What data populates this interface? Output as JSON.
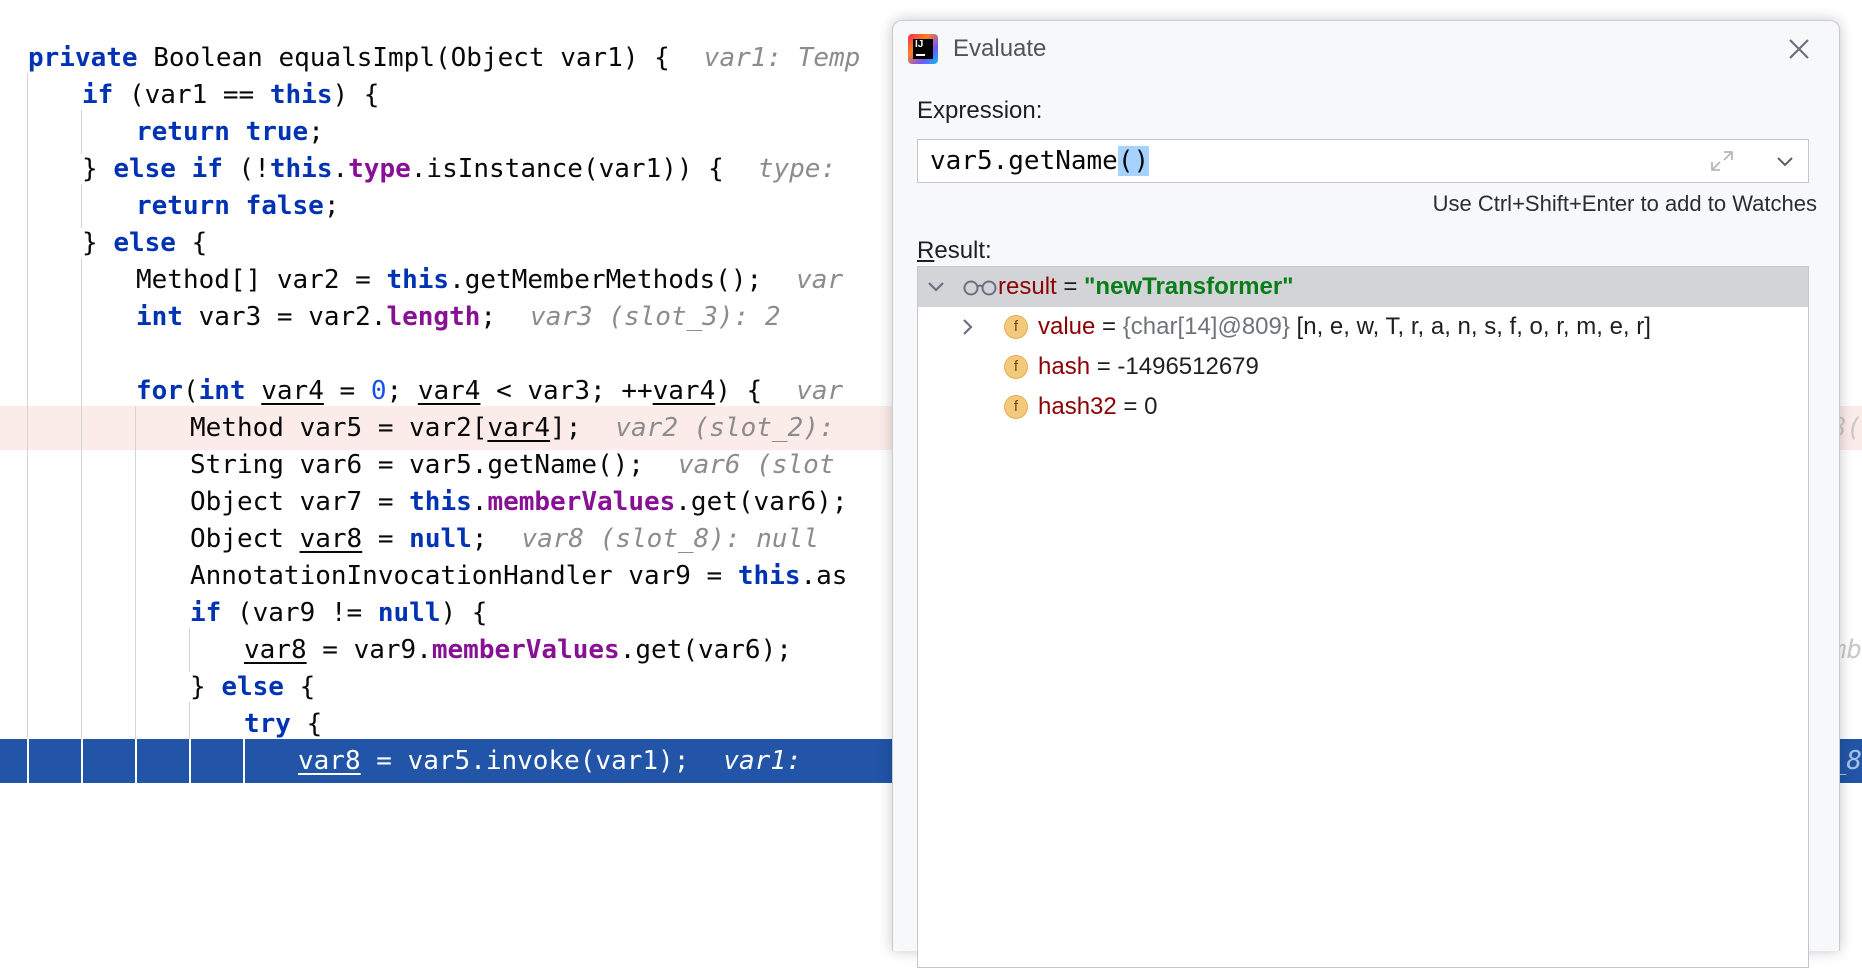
{
  "editor": {
    "lines": [
      {
        "parts": [
          {
            "t": "private",
            "c": "kw"
          },
          {
            "t": " Boolean equalsImpl(Object var1) {"
          }
        ],
        "hint": "var1: Temp"
      },
      {
        "parts": [
          {
            "t": "if",
            "c": "kw"
          },
          {
            "t": " (var1 == "
          },
          {
            "t": "this",
            "c": "kw"
          },
          {
            "t": ") {"
          }
        ]
      },
      {
        "parts": [
          {
            "t": "return true",
            "c": "kw"
          },
          {
            "t": ";"
          }
        ]
      },
      {
        "parts": [
          {
            "t": "} "
          },
          {
            "t": "else if",
            "c": "kw"
          },
          {
            "t": " (!"
          },
          {
            "t": "this",
            "c": "kw"
          },
          {
            "t": "."
          },
          {
            "t": "type",
            "c": "fld"
          },
          {
            "t": ".isInstance(var1)) {"
          }
        ],
        "hint": "type: "
      },
      {
        "parts": [
          {
            "t": "return false",
            "c": "kw"
          },
          {
            "t": ";"
          }
        ]
      },
      {
        "parts": [
          {
            "t": "} "
          },
          {
            "t": "else",
            "c": "kw"
          },
          {
            "t": " {"
          }
        ]
      },
      {
        "parts": [
          {
            "t": "Method[] var2 = "
          },
          {
            "t": "this",
            "c": "kw"
          },
          {
            "t": ".getMemberMethods();"
          }
        ],
        "hint": "var"
      },
      {
        "parts": [
          {
            "t": "int",
            "c": "kw"
          },
          {
            "t": " var3 = var2."
          },
          {
            "t": "length",
            "c": "fld"
          },
          {
            "t": ";"
          }
        ],
        "hint": "var3 (slot_3): 2"
      },
      {
        "parts": []
      },
      {
        "parts": [
          {
            "t": "for",
            "c": "kw"
          },
          {
            "t": "("
          },
          {
            "t": "int",
            "c": "kw"
          },
          {
            "t": " "
          },
          {
            "t": "var4",
            "c": "u"
          },
          {
            "t": " = "
          },
          {
            "t": "0",
            "c": "num"
          },
          {
            "t": "; "
          },
          {
            "t": "var4",
            "c": "u"
          },
          {
            "t": " < var3; ++"
          },
          {
            "t": "var4",
            "c": "u"
          },
          {
            "t": ") {"
          }
        ],
        "hint": "var"
      },
      {
        "parts": [
          {
            "t": "Method var5 = var2["
          },
          {
            "t": "var4",
            "c": "u"
          },
          {
            "t": "];"
          }
        ],
        "hint": "var2 (slot_2):",
        "right": "8("
      },
      {
        "parts": [
          {
            "t": "String var6 = var5.getName();"
          }
        ],
        "hint": "var6 (slot"
      },
      {
        "parts": [
          {
            "t": "Object var7 = "
          },
          {
            "t": "this",
            "c": "kw"
          },
          {
            "t": "."
          },
          {
            "t": "memberValues",
            "c": "fld"
          },
          {
            "t": ".get(var6);"
          }
        ]
      },
      {
        "parts": [
          {
            "t": "Object "
          },
          {
            "t": "var8",
            "c": "u"
          },
          {
            "t": " = "
          },
          {
            "t": "null",
            "c": "kw"
          },
          {
            "t": ";"
          }
        ],
        "hint": "var8 (slot_8): null"
      },
      {
        "parts": [
          {
            "t": "AnnotationInvocationHandler var9 = "
          },
          {
            "t": "this",
            "c": "kw"
          },
          {
            "t": ".as"
          }
        ]
      },
      {
        "parts": [
          {
            "t": "if",
            "c": "kw"
          },
          {
            "t": " (var9 != "
          },
          {
            "t": "null",
            "c": "kw"
          },
          {
            "t": ") {"
          }
        ]
      },
      {
        "parts": [
          {
            "t": "var8",
            "c": "u"
          },
          {
            "t": " = var9."
          },
          {
            "t": "memberValues",
            "c": "fld"
          },
          {
            "t": ".get(var6);"
          }
        ],
        "right": "mb"
      },
      {
        "parts": [
          {
            "t": "} "
          },
          {
            "t": "else",
            "c": "kw"
          },
          {
            "t": " {"
          }
        ]
      },
      {
        "parts": [
          {
            "t": "try",
            "c": "kw"
          },
          {
            "t": " {"
          }
        ]
      },
      {
        "parts": [
          {
            "t": "var8",
            "c": "u"
          },
          {
            "t": " = var5.invoke(var1);"
          }
        ],
        "hint": "var1: ",
        "right": "_8"
      }
    ]
  },
  "dialog": {
    "title": "Evaluate",
    "expression_label": "Expression:",
    "expression_value": "var5.getName",
    "expression_selected": "()",
    "hint": "Use Ctrl+Shift+Enter to add to Watches",
    "result_label_mnemonic": "R",
    "result_label_rest": "esult:",
    "result": {
      "name": "result",
      "eq": " = ",
      "value": "\"newTransformer\"",
      "children": [
        {
          "badge": "f",
          "name": "value",
          "eq": " = ",
          "meta": "{char[14]@809}",
          "val": " [n, e, w, T, r, a, n, s, f, o, r, m, e, r]"
        },
        {
          "badge": "f",
          "name": "hash",
          "eq": " = ",
          "val": "-1496512679"
        },
        {
          "badge": "f",
          "name": "hash32",
          "eq": " = ",
          "val": "0"
        }
      ]
    }
  }
}
